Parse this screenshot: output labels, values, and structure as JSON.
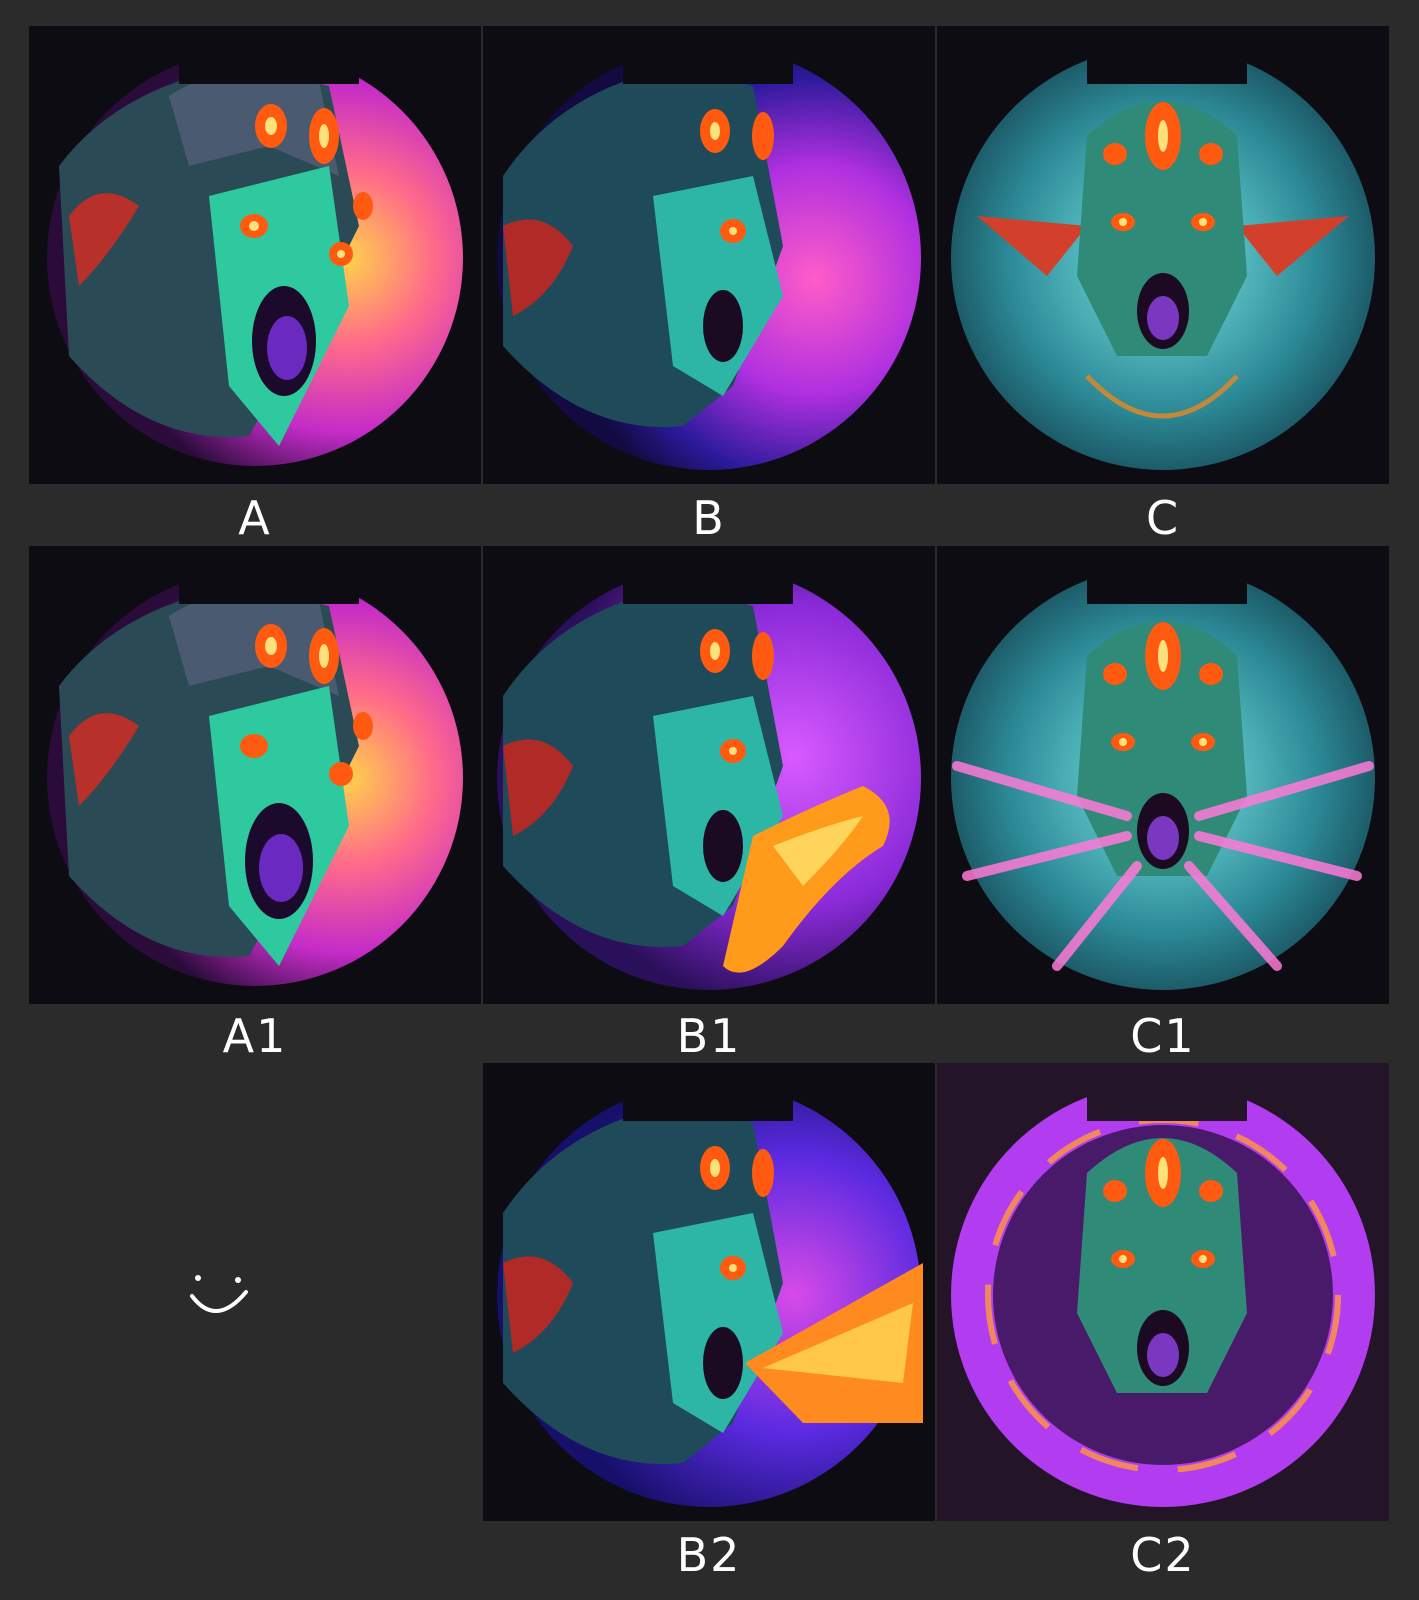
{
  "sheet": {
    "background": "#2b2b2b",
    "tiles": [
      {
        "label": "A",
        "variant": "side-roar",
        "aura": "fire-burst",
        "accent": "#ff5aa8"
      },
      {
        "label": "B",
        "variant": "profile-roar",
        "aura": "purple-swirl",
        "accent": "#c43cff"
      },
      {
        "label": "C",
        "variant": "front-roar",
        "aura": "cyan-wisps",
        "accent": "#3fe8ea"
      },
      {
        "label": "A1",
        "variant": "side-roar",
        "aura": "fire-burst",
        "accent": "#ff5aa8"
      },
      {
        "label": "B1",
        "variant": "profile-roar",
        "aura": "fire-breath",
        "accent": "#ff9a1a"
      },
      {
        "label": "C1",
        "variant": "front-roar",
        "aura": "pink-rays",
        "accent": "#ff78d8"
      },
      {
        "label": "B2",
        "variant": "profile-roar",
        "aura": "fire-stream",
        "accent": "#ffb020"
      },
      {
        "label": "C2",
        "variant": "front-roar",
        "aura": "purple-ring",
        "accent": "#b23cf0"
      }
    ],
    "smiley_icon": "smiley-face-doodle"
  }
}
